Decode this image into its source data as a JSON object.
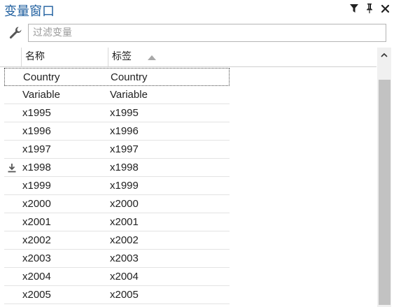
{
  "panel": {
    "title": "变量窗口",
    "icons": {
      "filter": "filter-icon",
      "pin": "pin-icon",
      "close": "close-icon"
    }
  },
  "filter": {
    "icon": "wrench-icon",
    "value": "",
    "placeholder": "过滤变量"
  },
  "table": {
    "columns": [
      "名称",
      "标签"
    ],
    "sorted_column": "标签",
    "sort_direction": "ascending",
    "rows": [
      {
        "name": "Country",
        "label": "Country",
        "selected": true,
        "icon": ""
      },
      {
        "name": "Variable",
        "label": "Variable",
        "selected": false,
        "icon": ""
      },
      {
        "name": "x1995",
        "label": "x1995",
        "selected": false,
        "icon": ""
      },
      {
        "name": "x1996",
        "label": "x1996",
        "selected": false,
        "icon": ""
      },
      {
        "name": "x1997",
        "label": "x1997",
        "selected": false,
        "icon": ""
      },
      {
        "name": "x1998",
        "label": "x1998",
        "selected": false,
        "icon": "download-arrow-icon"
      },
      {
        "name": "x1999",
        "label": "x1999",
        "selected": false,
        "icon": ""
      },
      {
        "name": "x2000",
        "label": "x2000",
        "selected": false,
        "icon": ""
      },
      {
        "name": "x2001",
        "label": "x2001",
        "selected": false,
        "icon": ""
      },
      {
        "name": "x2002",
        "label": "x2002",
        "selected": false,
        "icon": ""
      },
      {
        "name": "x2003",
        "label": "x2003",
        "selected": false,
        "icon": ""
      },
      {
        "name": "x2004",
        "label": "x2004",
        "selected": false,
        "icon": ""
      },
      {
        "name": "x2005",
        "label": "x2005",
        "selected": false,
        "icon": ""
      }
    ]
  },
  "colors": {
    "title": "#1f5f9f",
    "scroll_thumb": "#c2c2c2",
    "scroll_track": "#f0f0f0"
  }
}
